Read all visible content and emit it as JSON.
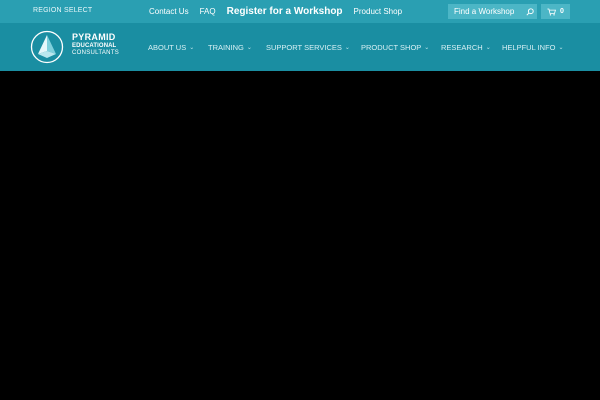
{
  "topbar": {
    "region_label": "REGION SELECT",
    "links": [
      "Contact Us",
      "FAQ",
      "Register for a Workshop",
      "Product Shop"
    ],
    "find_label": "Find a Workshop",
    "cart_count": "0"
  },
  "brand": {
    "line1": "PYRAMID",
    "line2": "EDUCATIONAL",
    "line3": "CONSULTANTS"
  },
  "nav": {
    "items": [
      "ABOUT US",
      "TRAINING",
      "SUPPORT SERVICES",
      "PRODUCT SHOP",
      "RESEARCH",
      "HELPFUL INFO"
    ]
  },
  "colors": {
    "topbar": "#2a9fb2",
    "navbar": "#1a8ea2",
    "main": "#000000"
  },
  "icons": [
    "search-icon",
    "cart-icon",
    "chevron-down-icon",
    "pyramid-logo"
  ]
}
